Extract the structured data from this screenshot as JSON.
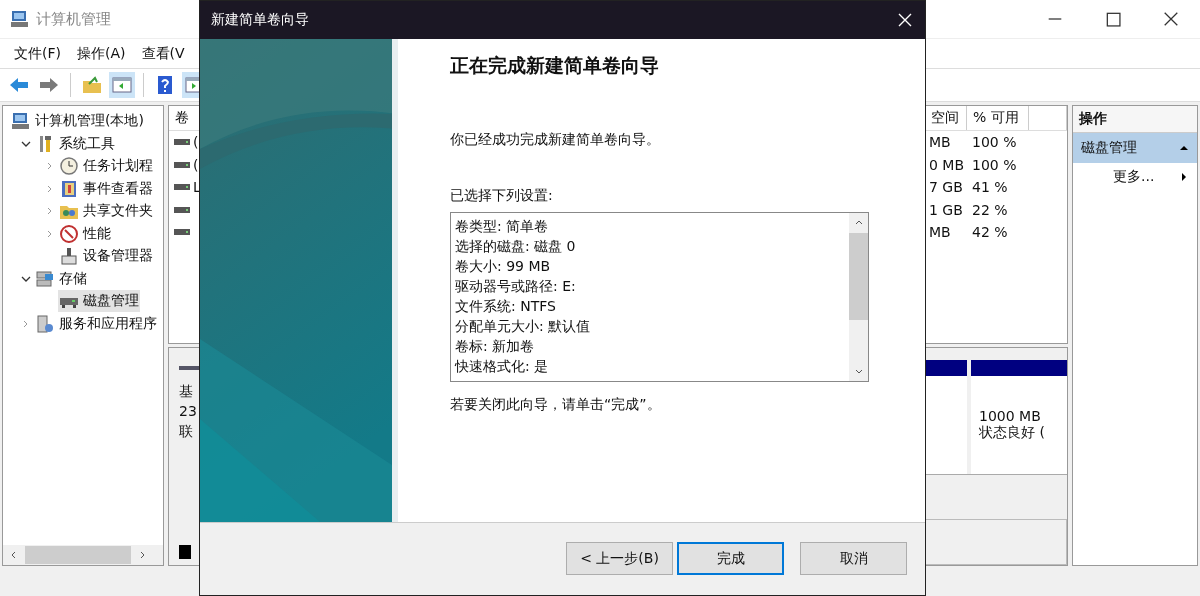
{
  "window": {
    "title": "计算机管理"
  },
  "menu": [
    "文件(F)",
    "操作(A)",
    "查看(V"
  ],
  "tree": {
    "items": [
      {
        "label": "计算机管理(本地)",
        "kind": "computer",
        "selected": false,
        "children": [
          {
            "label": "系统工具",
            "kind": "tools",
            "expanded": true,
            "selected": false,
            "children": [
              {
                "label": "任务计划程",
                "kind": "clock",
                "expanded": false,
                "selected": false
              },
              {
                "label": "事件查看器",
                "kind": "log",
                "expanded": false,
                "selected": false
              },
              {
                "label": "共享文件夹",
                "kind": "share",
                "expanded": false,
                "selected": false
              },
              {
                "label": "性能",
                "kind": "gauge",
                "expanded": false,
                "selected": false
              },
              {
                "label": "设备管理器",
                "kind": "device",
                "selected": false
              }
            ]
          },
          {
            "label": "存储",
            "kind": "storage",
            "expanded": true,
            "selected": false,
            "children": [
              {
                "label": "磁盘管理",
                "kind": "disk",
                "selected": true
              }
            ]
          },
          {
            "label": "服务和应用程序",
            "kind": "services",
            "expanded": false,
            "selected": false
          }
        ]
      }
    ]
  },
  "volume_list": {
    "columns": [
      "卷",
      "空间",
      "% 可用"
    ],
    "rows": [
      {
        "volume": "(",
        "free": "MB",
        "percent": "100 %"
      },
      {
        "volume": "(",
        "free": "0 MB",
        "percent": "100 %"
      },
      {
        "volume": "L",
        "free": "7 GB",
        "percent": "41 %"
      },
      {
        "free": "1 GB",
        "percent": "22 %"
      },
      {
        "free": "MB",
        "percent": "42 %"
      }
    ]
  },
  "disk_map": {
    "disk_info": [
      "基",
      "23",
      "联"
    ],
    "partitions": [
      {
        "size": "1000 MB",
        "status": "状态良好 ("
      }
    ]
  },
  "actions": {
    "title": "操作",
    "items": [
      {
        "label": "磁盘管理",
        "kind": "section"
      },
      {
        "label": "更多...",
        "kind": "submenu"
      }
    ]
  },
  "dialog": {
    "title": "新建简单卷向导",
    "heading": "正在完成新建简单卷向导",
    "intro": "你已经成功完成新建简单卷向导。",
    "settings_label": "已选择下列设置:",
    "settings": [
      "卷类型: 简单卷",
      "选择的磁盘: 磁盘 0",
      "卷大小: 99 MB",
      "驱动器号或路径: E:",
      "文件系统: NTFS",
      "分配单元大小: 默认值",
      "卷标: 新加卷",
      "快速格式化: 是"
    ],
    "closing": "若要关闭此向导，请单击“完成”。",
    "buttons": [
      {
        "label": "< 上一步(B)",
        "default": false
      },
      {
        "label": "完成",
        "default": true
      },
      {
        "label": "取消",
        "default": false
      }
    ]
  }
}
